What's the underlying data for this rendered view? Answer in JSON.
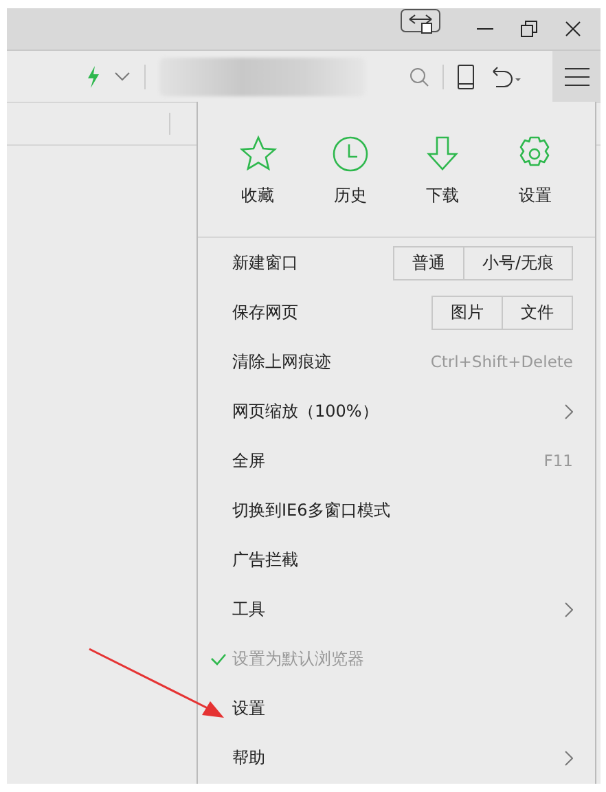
{
  "menu": {
    "quick_actions": [
      {
        "label": "收藏"
      },
      {
        "label": "历史"
      },
      {
        "label": "下载"
      },
      {
        "label": "设置"
      }
    ],
    "items": [
      {
        "kind": "buttons",
        "label": "新建窗口",
        "buttons": [
          "普通",
          "小号/无痕"
        ]
      },
      {
        "kind": "buttons",
        "label": "保存网页",
        "buttons": [
          "图片",
          "文件"
        ]
      },
      {
        "kind": "shortcut",
        "label": "清除上网痕迹",
        "shortcut": "Ctrl+Shift+Delete"
      },
      {
        "kind": "submenu",
        "label": "网页缩放（100%）"
      },
      {
        "kind": "shortcut",
        "label": "全屏",
        "shortcut": "F11"
      },
      {
        "kind": "plain",
        "label": "切换到IE6多窗口模式"
      },
      {
        "kind": "plain",
        "label": "广告拦截"
      },
      {
        "kind": "submenu",
        "label": "工具"
      },
      {
        "kind": "check",
        "label": "设置为默认浏览器",
        "checked": true,
        "disabled": true
      },
      {
        "kind": "plain",
        "label": "设置"
      },
      {
        "kind": "submenu",
        "label": "帮助"
      }
    ]
  }
}
